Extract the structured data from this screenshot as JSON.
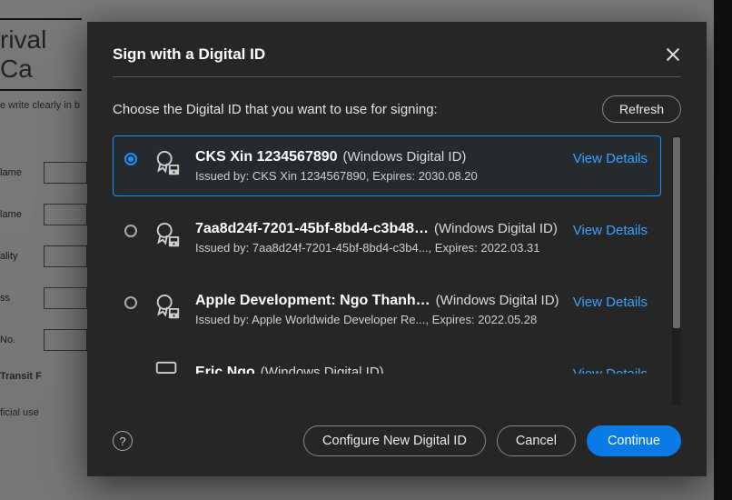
{
  "background": {
    "title": "rival Ca",
    "subtitle": "e write clearly in b",
    "rows": [
      {
        "label": "lame"
      },
      {
        "label": "lame"
      },
      {
        "label": "ality"
      },
      {
        "label": "ss"
      },
      {
        "label": "No."
      }
    ],
    "transit": "Transit  F",
    "official": "ficial use"
  },
  "modal": {
    "title": "Sign with a Digital ID",
    "instruction": "Choose the Digital ID that you want to use for signing:",
    "refresh": "Refresh",
    "view_details": "View Details",
    "items": [
      {
        "name": "CKS Xin 1234567890",
        "type": "(Windows Digital ID)",
        "issued": "Issued by: CKS Xin 1234567890, Expires: 2030.08.20",
        "selected": true
      },
      {
        "name": "7aa8d24f-7201-45bf-8bd4-c3b48…",
        "type": "(Windows Digital ID)",
        "issued": "Issued by: 7aa8d24f-7201-45bf-8bd4-c3b4..., Expires: 2022.03.31",
        "selected": false
      },
      {
        "name": "Apple Development: Ngo Thanh…",
        "type": "(Windows Digital ID)",
        "issued": "Issued by: Apple Worldwide Developer Re..., Expires: 2022.05.28",
        "selected": false
      },
      {
        "name": "Eric Ngo",
        "type": "(Windows Digital ID)",
        "issued": "",
        "selected": false
      }
    ],
    "buttons": {
      "configure": "Configure New Digital ID",
      "cancel": "Cancel",
      "continue": "Continue"
    }
  }
}
